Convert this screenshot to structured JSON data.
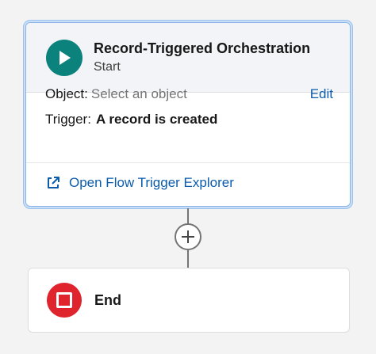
{
  "start_node": {
    "title": "Record-Triggered Orchestration",
    "subtitle": "Start",
    "object_label": "Object:",
    "object_placeholder": "Select an object",
    "edit_label": "Edit",
    "trigger_label": "Trigger:",
    "trigger_value": "A record is created",
    "explorer_link": "Open Flow Trigger Explorer",
    "icon": "play-icon"
  },
  "end_node": {
    "label": "End",
    "icon": "stop-icon"
  },
  "add_element": {
    "icon": "plus-icon"
  },
  "colors": {
    "start_icon": "#0b827c",
    "end_icon": "#e0242e",
    "link": "#0b5cab",
    "selection_border": "#8ab4e6"
  }
}
